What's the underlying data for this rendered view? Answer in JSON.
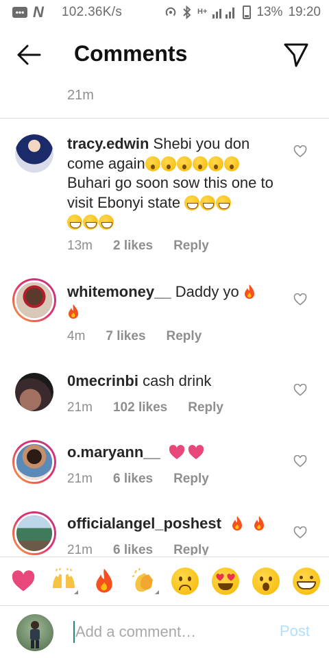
{
  "status_bar": {
    "speed": "102.36K/s",
    "network": "H+",
    "battery": "13%",
    "time": "19:20"
  },
  "header": {
    "title": "Comments"
  },
  "previous_comment_time": "21m",
  "comments": [
    {
      "username": "tracy.edwin",
      "text_1": "Shebi you don come again",
      "text_2": "Buhari go soon sow this one to visit Ebonyi state",
      "time": "13m",
      "likes": "2 likes",
      "reply": "Reply"
    },
    {
      "username": "whitemoney__",
      "text": "Daddy yo",
      "time": "4m",
      "likes": "7 likes",
      "reply": "Reply"
    },
    {
      "username": "0mecrinbi",
      "text": "cash drink",
      "time": "21m",
      "likes": "102 likes",
      "reply": "Reply"
    },
    {
      "username": "o.maryann__",
      "text": "",
      "time": "21m",
      "likes": "6 likes",
      "reply": "Reply"
    },
    {
      "username": "officialangel_poshest",
      "text": "",
      "time": "21m",
      "likes": "6 likes",
      "reply": "Reply"
    }
  ],
  "emoji_bar": [
    "heart-emoji",
    "raising-hands-emoji",
    "fire-emoji",
    "clapping-hands-emoji",
    "sad-face-emoji",
    "heart-eyes-emoji",
    "surprised-face-emoji",
    "grinning-face-emoji"
  ],
  "composer": {
    "placeholder": "Add a comment…",
    "post_label": "Post"
  },
  "colors": {
    "post_disabled": "#b2dffc",
    "meta_gray": "#8e8e8e",
    "story_ring_start": "#f9a23a",
    "story_ring_end": "#c13584"
  }
}
